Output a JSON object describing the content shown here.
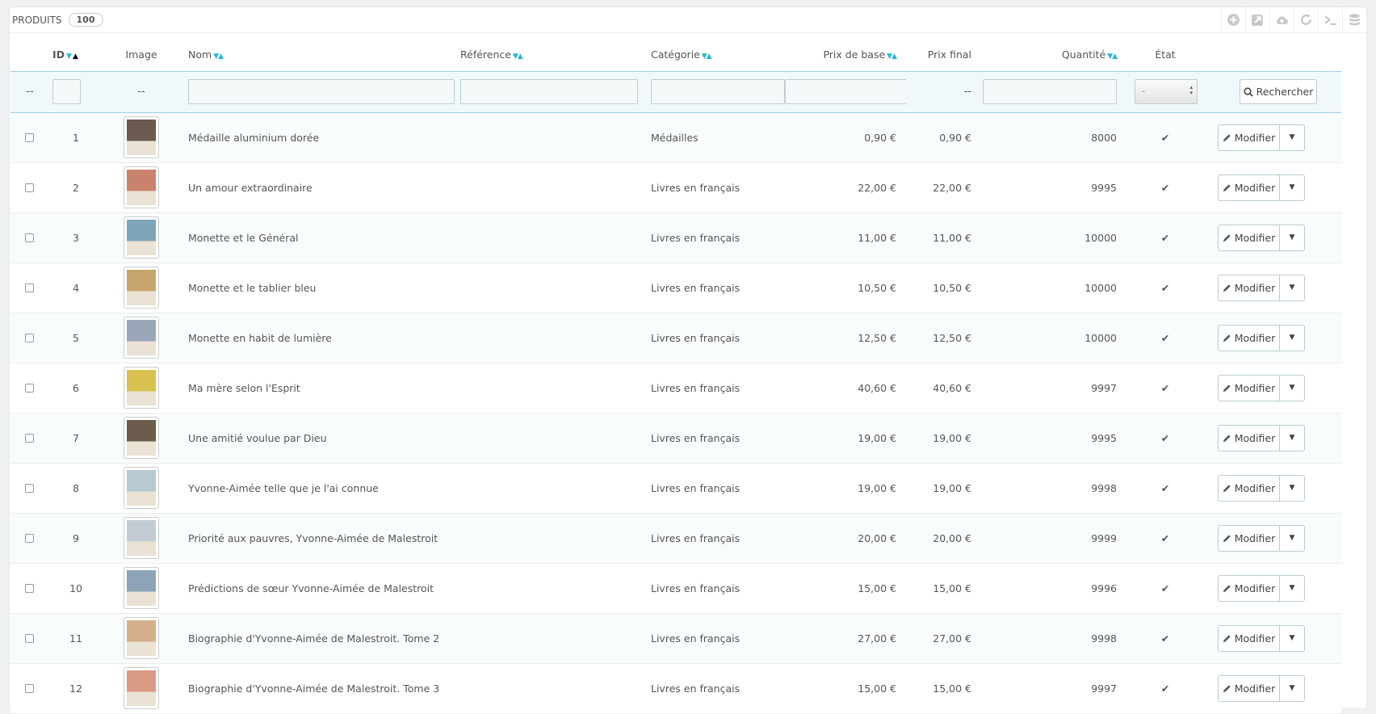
{
  "panel": {
    "title": "Produits",
    "count": "100"
  },
  "toolbar": [
    {
      "name": "add-icon"
    },
    {
      "name": "export-icon"
    },
    {
      "name": "cloud-upload-icon"
    },
    {
      "name": "refresh-icon"
    },
    {
      "name": "terminal-icon"
    },
    {
      "name": "database-icon"
    }
  ],
  "columns": {
    "id": "ID",
    "image": "Image",
    "name": "Nom",
    "reference": "Référence",
    "category": "Catégorie",
    "base_price": "Prix de base",
    "final_price": "Prix final",
    "quantity": "Quantité",
    "status": "État"
  },
  "filters": {
    "checkbox_placeholder": "--",
    "image_placeholder": "--",
    "final_price_placeholder": "--",
    "status_selected": "-",
    "search_label": "Rechercher"
  },
  "row_actions": {
    "edit_label": "Modifier"
  },
  "products": [
    {
      "id": "1",
      "name": "Médaille aluminium dorée",
      "reference": "",
      "category": "Médailles",
      "base_price": "0,90 €",
      "final_price": "0,90 €",
      "quantity": "8000",
      "active": true,
      "thumb_color": "#6a5a4f"
    },
    {
      "id": "2",
      "name": "Un amour extraordinaire",
      "reference": "",
      "category": "Livres en français",
      "base_price": "22,00 €",
      "final_price": "22,00 €",
      "quantity": "9995",
      "active": true,
      "thumb_color": "#c9826b"
    },
    {
      "id": "3",
      "name": "Monette et le Général",
      "reference": "",
      "category": "Livres en français",
      "base_price": "11,00 €",
      "final_price": "11,00 €",
      "quantity": "10000",
      "active": true,
      "thumb_color": "#7ea6b8"
    },
    {
      "id": "4",
      "name": "Monette et le tablier bleu",
      "reference": "",
      "category": "Livres en français",
      "base_price": "10,50 €",
      "final_price": "10,50 €",
      "quantity": "10000",
      "active": true,
      "thumb_color": "#c7a46b"
    },
    {
      "id": "5",
      "name": "Monette en habit de lumière",
      "reference": "",
      "category": "Livres en français",
      "base_price": "12,50 €",
      "final_price": "12,50 €",
      "quantity": "10000",
      "active": true,
      "thumb_color": "#9aa7b8"
    },
    {
      "id": "6",
      "name": "Ma mère selon l'Esprit",
      "reference": "",
      "category": "Livres en français",
      "base_price": "40,60 €",
      "final_price": "40,60 €",
      "quantity": "9997",
      "active": true,
      "thumb_color": "#d8c14f"
    },
    {
      "id": "7",
      "name": "Une amitié voulue par Dieu",
      "reference": "",
      "category": "Livres en français",
      "base_price": "19,00 €",
      "final_price": "19,00 €",
      "quantity": "9995",
      "active": true,
      "thumb_color": "#6d5c4c"
    },
    {
      "id": "8",
      "name": "Yvonne-Aimée telle que je l'ai connue",
      "reference": "",
      "category": "Livres en français",
      "base_price": "19,00 €",
      "final_price": "19,00 €",
      "quantity": "9998",
      "active": true,
      "thumb_color": "#b7c9d1"
    },
    {
      "id": "9",
      "name": "Priorité aux pauvres, Yvonne-Aimée de Malestroit",
      "reference": "",
      "category": "Livres en français",
      "base_price": "20,00 €",
      "final_price": "20,00 €",
      "quantity": "9999",
      "active": true,
      "thumb_color": "#c3ccd4"
    },
    {
      "id": "10",
      "name": "Prédictions de sœur Yvonne-Aimée de Malestroit",
      "reference": "",
      "category": "Livres en français",
      "base_price": "15,00 €",
      "final_price": "15,00 €",
      "quantity": "9996",
      "active": true,
      "thumb_color": "#8fa3b8"
    },
    {
      "id": "11",
      "name": "Biographie d'Yvonne-Aimée de Malestroit. Tome 2",
      "reference": "",
      "category": "Livres en français",
      "base_price": "27,00 €",
      "final_price": "27,00 €",
      "quantity": "9998",
      "active": true,
      "thumb_color": "#d6b08c"
    },
    {
      "id": "12",
      "name": "Biographie d'Yvonne-Aimée de Malestroit. Tome 3",
      "reference": "",
      "category": "Livres en français",
      "base_price": "15,00 €",
      "final_price": "15,00 €",
      "quantity": "9997",
      "active": true,
      "thumb_color": "#d99a84"
    }
  ]
}
